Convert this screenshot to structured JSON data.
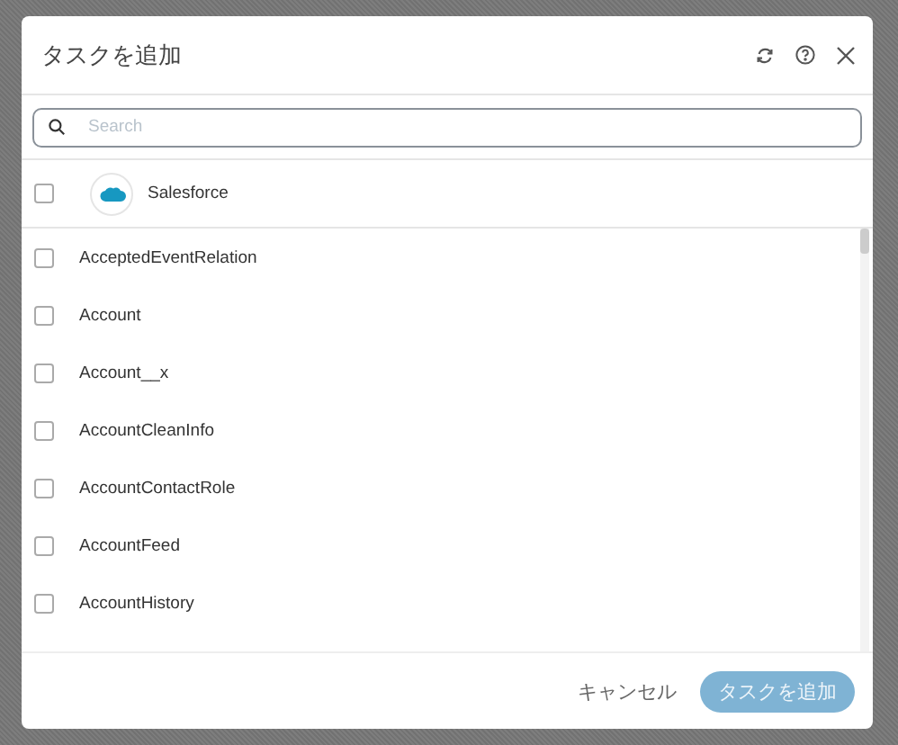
{
  "dialog": {
    "title": "タスクを追加"
  },
  "search": {
    "placeholder": "Search"
  },
  "connector": {
    "name": "Salesforce",
    "checked": false
  },
  "items": [
    {
      "label": "AcceptedEventRelation",
      "checked": false
    },
    {
      "label": "Account",
      "checked": false
    },
    {
      "label": "Account__x",
      "checked": false
    },
    {
      "label": "AccountCleanInfo",
      "checked": false
    },
    {
      "label": "AccountContactRole",
      "checked": false
    },
    {
      "label": "AccountFeed",
      "checked": false
    },
    {
      "label": "AccountHistory",
      "checked": false
    }
  ],
  "footer": {
    "cancel": "キャンセル",
    "submit": {
      "label": "タスクを追加",
      "disabled": true
    }
  }
}
